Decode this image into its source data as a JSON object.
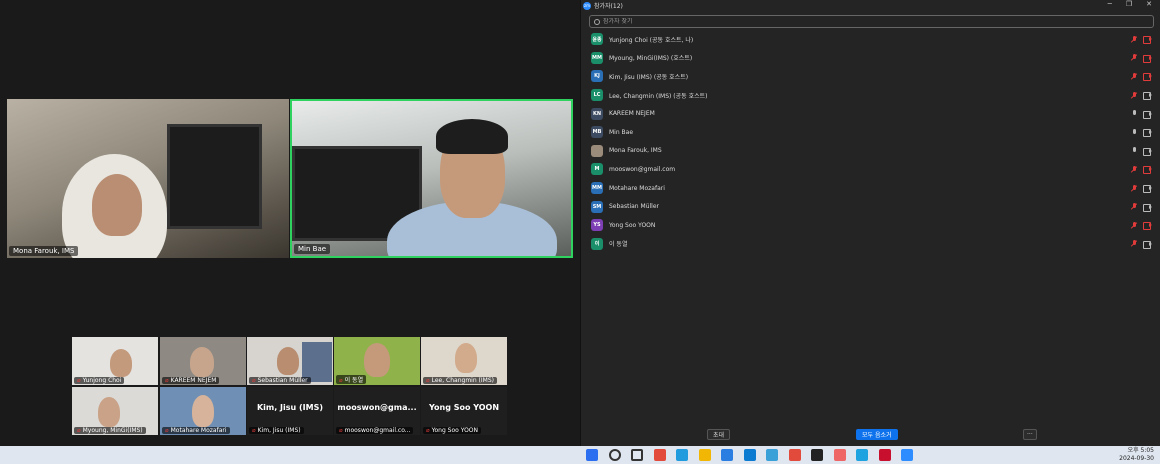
{
  "meeting": {
    "main_tiles": [
      {
        "name": "Mona Farouk, IMS"
      },
      {
        "name": "Min Bae"
      }
    ],
    "gallery": [
      {
        "name": "Yunjong Choi",
        "muted": true,
        "video": true
      },
      {
        "name": "KAREEM NEJEM",
        "muted": true,
        "video": true
      },
      {
        "name": "Sebastian Müller",
        "muted": true,
        "video": true
      },
      {
        "name": "이 동열",
        "muted": true,
        "video": true
      },
      {
        "name": "Lee, Changmin (IMS)",
        "muted": true,
        "video": true
      },
      {
        "name": "Myoung, MinGi(IMS)",
        "muted": true,
        "video": true
      },
      {
        "name": "Motahare Mozafari",
        "muted": true,
        "video": true
      },
      {
        "name": "Kim, Jisu (IMS)",
        "big": "Kim, Jisu (IMS)",
        "muted": true,
        "video": false
      },
      {
        "name": "mooswon@gmail.co...",
        "big": "mooswon@gma...",
        "muted": true,
        "video": false
      },
      {
        "name": "Yong Soo YOON",
        "big": "Yong Soo YOON",
        "muted": true,
        "video": false
      }
    ]
  },
  "panel": {
    "title": "참가자(12)",
    "search_placeholder": "참가자 찾기",
    "participants": [
      {
        "initials": "윤종",
        "color": "#1a8f6a",
        "name": "Yunjong Choi (공동 호스트, 나)",
        "mic": "muted",
        "cam": "off"
      },
      {
        "initials": "MM",
        "color": "#1a8f6a",
        "name": "Myoung, MinGi(IMS) (호스트)",
        "mic": "muted",
        "cam": "off"
      },
      {
        "initials": "KJ",
        "color": "#2a6fb5",
        "name": "Kim, Jisu (IMS) (공동 호스트)",
        "mic": "muted",
        "cam": "off"
      },
      {
        "initials": "LC",
        "color": "#1a8f6a",
        "name": "Lee, Changmin (IMS) (공동 호스트)",
        "mic": "muted",
        "cam": "on"
      },
      {
        "initials": "KN",
        "color": "#3c4b61",
        "name": "KAREEM NEJEM",
        "mic": "on",
        "cam": "on"
      },
      {
        "initials": "MB",
        "color": "#3c4b61",
        "name": "Min Bae",
        "mic": "on",
        "cam": "on"
      },
      {
        "initials": "",
        "color": "#9a8b7a",
        "name": "Mona Farouk, IMS",
        "mic": "on",
        "cam": "on"
      },
      {
        "initials": "M",
        "color": "#1a8f6a",
        "name": "mooswon@gmail.com",
        "mic": "muted",
        "cam": "off"
      },
      {
        "initials": "MM",
        "color": "#2a6fb5",
        "name": "Motahare Mozafari",
        "mic": "muted",
        "cam": "on"
      },
      {
        "initials": "SM",
        "color": "#2a6fb5",
        "name": "Sebastian Müller",
        "mic": "muted",
        "cam": "on"
      },
      {
        "initials": "YS",
        "color": "#7d3fb3",
        "name": "Yong Soo YOON",
        "mic": "muted",
        "cam": "off"
      },
      {
        "initials": "이",
        "color": "#1a8f6a",
        "name": "이 동열",
        "mic": "muted",
        "cam": "on"
      }
    ],
    "invite_label": "초대",
    "mute_all_label": "모두 음소거",
    "more_label": "···"
  },
  "taskbar": {
    "icons": [
      "windows-icon",
      "search-icon",
      "task-view-icon",
      "chrome-icon",
      "edge-icon",
      "file-explorer-icon",
      "mail-icon",
      "store-icon",
      "app-icon",
      "chrome-icon-2",
      "notes-icon",
      "paint-icon",
      "app-blue-icon",
      "mcafee-icon",
      "zoom-icon"
    ],
    "time": "오후 5:05",
    "date": "2024-09-30"
  }
}
